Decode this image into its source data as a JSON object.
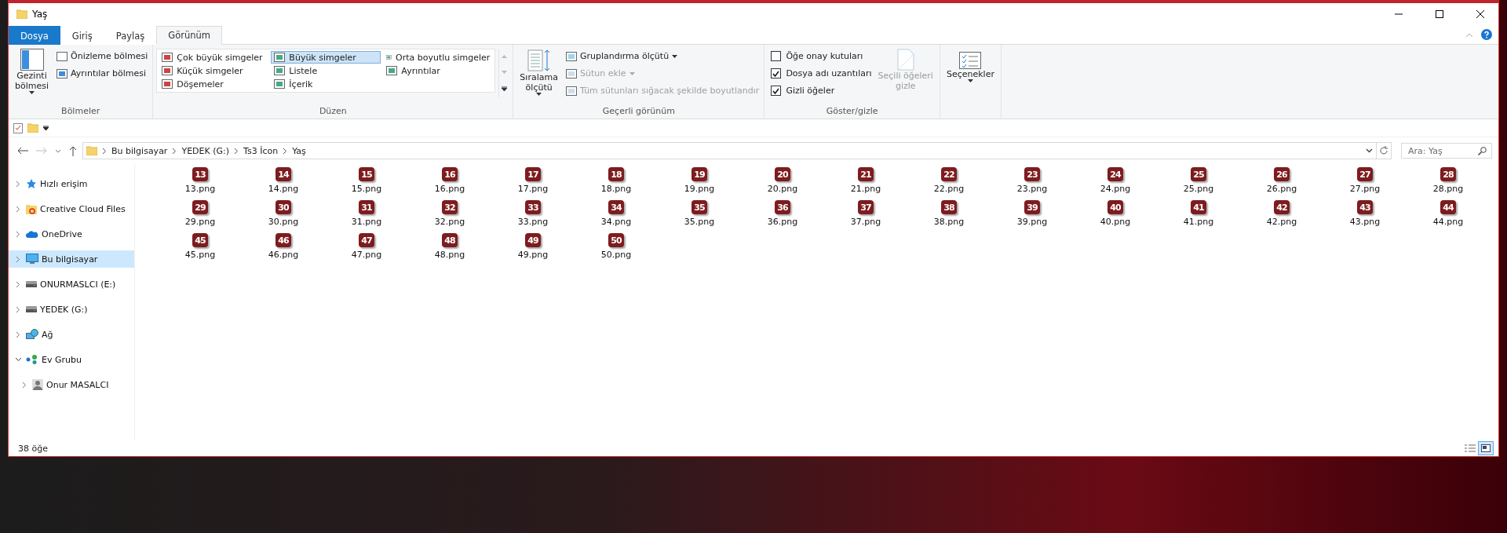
{
  "window": {
    "title": "Yaş"
  },
  "ribbon_tabs": [
    {
      "label": "Dosya",
      "kind": "file",
      "selected": false
    },
    {
      "label": "Giriş",
      "kind": "tab",
      "selected": false
    },
    {
      "label": "Paylaş",
      "kind": "tab",
      "selected": false
    },
    {
      "label": "Görünüm",
      "kind": "tab",
      "selected": true
    }
  ],
  "panes": {
    "big": {
      "label": "Gezinti bölmesi"
    },
    "small": [
      {
        "label": "Önizleme bölmesi"
      },
      {
        "label": "Ayrıntılar bölmesi"
      }
    ],
    "group": "Bölmeler"
  },
  "layouts": {
    "items": [
      {
        "label": "Çok büyük simgeler",
        "selected": false
      },
      {
        "label": "Büyük simgeler",
        "selected": true
      },
      {
        "label": "Orta boyutlu simgeler",
        "selected": false
      },
      {
        "label": "Küçük simgeler",
        "selected": false
      },
      {
        "label": "Listele",
        "selected": false
      },
      {
        "label": "Ayrıntılar",
        "selected": false
      },
      {
        "label": "Döşemeler",
        "selected": false
      },
      {
        "label": "İçerik",
        "selected": false
      }
    ],
    "group": "Düzen"
  },
  "current_view": {
    "sort": "Sıralama ölçütü",
    "items": [
      {
        "label": "Gruplandırma ölçütü",
        "disabled": false,
        "dropdown": true
      },
      {
        "label": "Sütun ekle",
        "disabled": true,
        "dropdown": true
      },
      {
        "label": "Tüm sütunları sığacak şekilde boyutlandır",
        "disabled": true,
        "dropdown": false
      }
    ],
    "group": "Geçerli görünüm"
  },
  "show_hide": {
    "checks": [
      {
        "label": "Öğe onay kutuları",
        "checked": false
      },
      {
        "label": "Dosya adı uzantıları",
        "checked": true
      },
      {
        "label": "Gizli öğeler",
        "checked": true
      }
    ],
    "hide_selected": {
      "label": "Seçili öğeleri gizle",
      "disabled": true
    },
    "group": "Göster/gizle"
  },
  "options": {
    "label": "Seçenekler"
  },
  "address": {
    "segments": [
      "Bu bilgisayar",
      "YEDEK (G:)",
      "Ts3 İcon",
      "Yaş"
    ]
  },
  "search": {
    "placeholder": "Ara: Yaş"
  },
  "sidebar": [
    {
      "label": "Hızlı erişim",
      "kind": "star",
      "expanded": false,
      "selected": false
    },
    {
      "label": "Creative Cloud Files",
      "kind": "cloudfolder",
      "expanded": false,
      "selected": false
    },
    {
      "label": "OneDrive",
      "kind": "cloud",
      "expanded": false,
      "selected": false
    },
    {
      "label": "Bu bilgisayar",
      "kind": "pc",
      "expanded": false,
      "selected": true
    },
    {
      "label": "ONURMASLCI (E:)",
      "kind": "drive",
      "expanded": false,
      "selected": false
    },
    {
      "label": "YEDEK (G:)",
      "kind": "drive",
      "expanded": false,
      "selected": false
    },
    {
      "label": "Ağ",
      "kind": "network",
      "expanded": false,
      "selected": false
    },
    {
      "label": "Ev Grubu",
      "kind": "homegroup",
      "expanded": true,
      "selected": false,
      "children": [
        {
          "label": "Onur MASALCI",
          "kind": "user",
          "expanded": false,
          "selected": false
        }
      ]
    }
  ],
  "files": [
    {
      "name": "13.png",
      "badge": "13"
    },
    {
      "name": "14.png",
      "badge": "14"
    },
    {
      "name": "15.png",
      "badge": "15"
    },
    {
      "name": "16.png",
      "badge": "16"
    },
    {
      "name": "17.png",
      "badge": "17"
    },
    {
      "name": "18.png",
      "badge": "18"
    },
    {
      "name": "19.png",
      "badge": "19"
    },
    {
      "name": "20.png",
      "badge": "20"
    },
    {
      "name": "21.png",
      "badge": "21"
    },
    {
      "name": "22.png",
      "badge": "22"
    },
    {
      "name": "23.png",
      "badge": "23"
    },
    {
      "name": "24.png",
      "badge": "24"
    },
    {
      "name": "25.png",
      "badge": "25"
    },
    {
      "name": "26.png",
      "badge": "26"
    },
    {
      "name": "27.png",
      "badge": "27"
    },
    {
      "name": "28.png",
      "badge": "28"
    },
    {
      "name": "29.png",
      "badge": "29"
    },
    {
      "name": "30.png",
      "badge": "30"
    },
    {
      "name": "31.png",
      "badge": "31"
    },
    {
      "name": "32.png",
      "badge": "32"
    },
    {
      "name": "33.png",
      "badge": "33"
    },
    {
      "name": "34.png",
      "badge": "34"
    },
    {
      "name": "35.png",
      "badge": "35"
    },
    {
      "name": "36.png",
      "badge": "36"
    },
    {
      "name": "37.png",
      "badge": "37"
    },
    {
      "name": "38.png",
      "badge": "38"
    },
    {
      "name": "39.png",
      "badge": "39"
    },
    {
      "name": "40.png",
      "badge": "40"
    },
    {
      "name": "41.png",
      "badge": "41"
    },
    {
      "name": "42.png",
      "badge": "42"
    },
    {
      "name": "43.png",
      "badge": "43"
    },
    {
      "name": "44.png",
      "badge": "44"
    },
    {
      "name": "45.png",
      "badge": "45"
    },
    {
      "name": "46.png",
      "badge": "46"
    },
    {
      "name": "47.png",
      "badge": "47"
    },
    {
      "name": "48.png",
      "badge": "48"
    },
    {
      "name": "49.png",
      "badge": "49"
    },
    {
      "name": "50.png",
      "badge": "50"
    }
  ],
  "status": {
    "count": "38 öğe",
    "views": [
      {
        "kind": "details",
        "selected": false
      },
      {
        "kind": "icons",
        "selected": true
      }
    ]
  }
}
